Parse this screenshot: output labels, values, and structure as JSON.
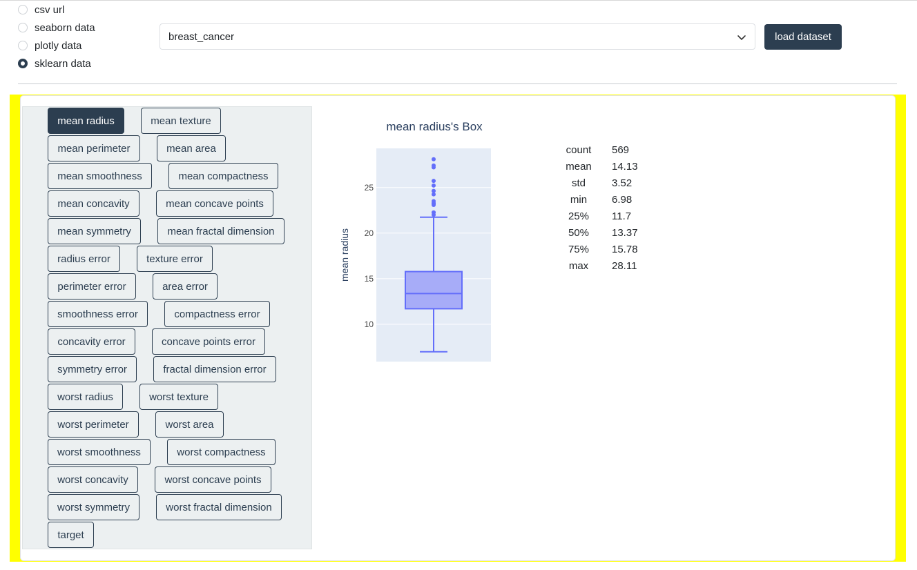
{
  "source_options": [
    {
      "label": "csv url",
      "checked": false
    },
    {
      "label": "seaborn data",
      "checked": false
    },
    {
      "label": "plotly data",
      "checked": false
    },
    {
      "label": "sklearn data",
      "checked": true
    }
  ],
  "dataset_select": {
    "value": "breast_cancer"
  },
  "load_button": {
    "label": "load dataset"
  },
  "columns": [
    [
      "mean radius",
      "mean texture"
    ],
    [
      "mean perimeter",
      "mean area"
    ],
    [
      "mean smoothness",
      "mean compactness"
    ],
    [
      "mean concavity",
      "mean concave points"
    ],
    [
      "mean symmetry",
      "mean fractal dimension"
    ],
    [
      "radius error",
      "texture error"
    ],
    [
      "perimeter error",
      "area error"
    ],
    [
      "smoothness error",
      "compactness error"
    ],
    [
      "concavity error",
      "concave points error"
    ],
    [
      "symmetry error",
      "fractal dimension error"
    ],
    [
      "worst radius",
      "worst texture"
    ],
    [
      "worst perimeter",
      "worst area"
    ],
    [
      "worst smoothness",
      "worst compactness"
    ],
    [
      "worst concavity",
      "worst concave points"
    ],
    [
      "worst symmetry",
      "worst fractal dimension"
    ],
    [
      "target"
    ]
  ],
  "selected_column": "mean radius",
  "chart_data": {
    "type": "box",
    "title": "mean radius's Box",
    "ylabel": "mean radius",
    "xlabel": "",
    "ylim": [
      5.9,
      29.3
    ],
    "yticks": [
      10,
      15,
      20,
      25
    ],
    "grid": true,
    "box": {
      "lower_fence": 6.98,
      "q1": 11.7,
      "median": 13.37,
      "q3": 15.78,
      "upper_fence": 21.75
    },
    "outliers": [
      22.01,
      22.27,
      22.27,
      23.09,
      23.21,
      23.27,
      23.29,
      23.51,
      24.25,
      24.63,
      25.22,
      25.73,
      27.22,
      27.42,
      28.11
    ],
    "colors": {
      "plot_bg": "#e5ecf6",
      "box": "#636efa",
      "fill": "#a7acf8"
    }
  },
  "stats": [
    {
      "key": "count",
      "value": "569"
    },
    {
      "key": "mean",
      "value": "14.13"
    },
    {
      "key": "std",
      "value": "3.52"
    },
    {
      "key": "min",
      "value": "6.98"
    },
    {
      "key": "25%",
      "value": "11.7"
    },
    {
      "key": "50%",
      "value": "13.37"
    },
    {
      "key": "75%",
      "value": "15.78"
    },
    {
      "key": "max",
      "value": "28.11"
    }
  ],
  "icons": {
    "dropdown": "chevron-down-icon"
  }
}
